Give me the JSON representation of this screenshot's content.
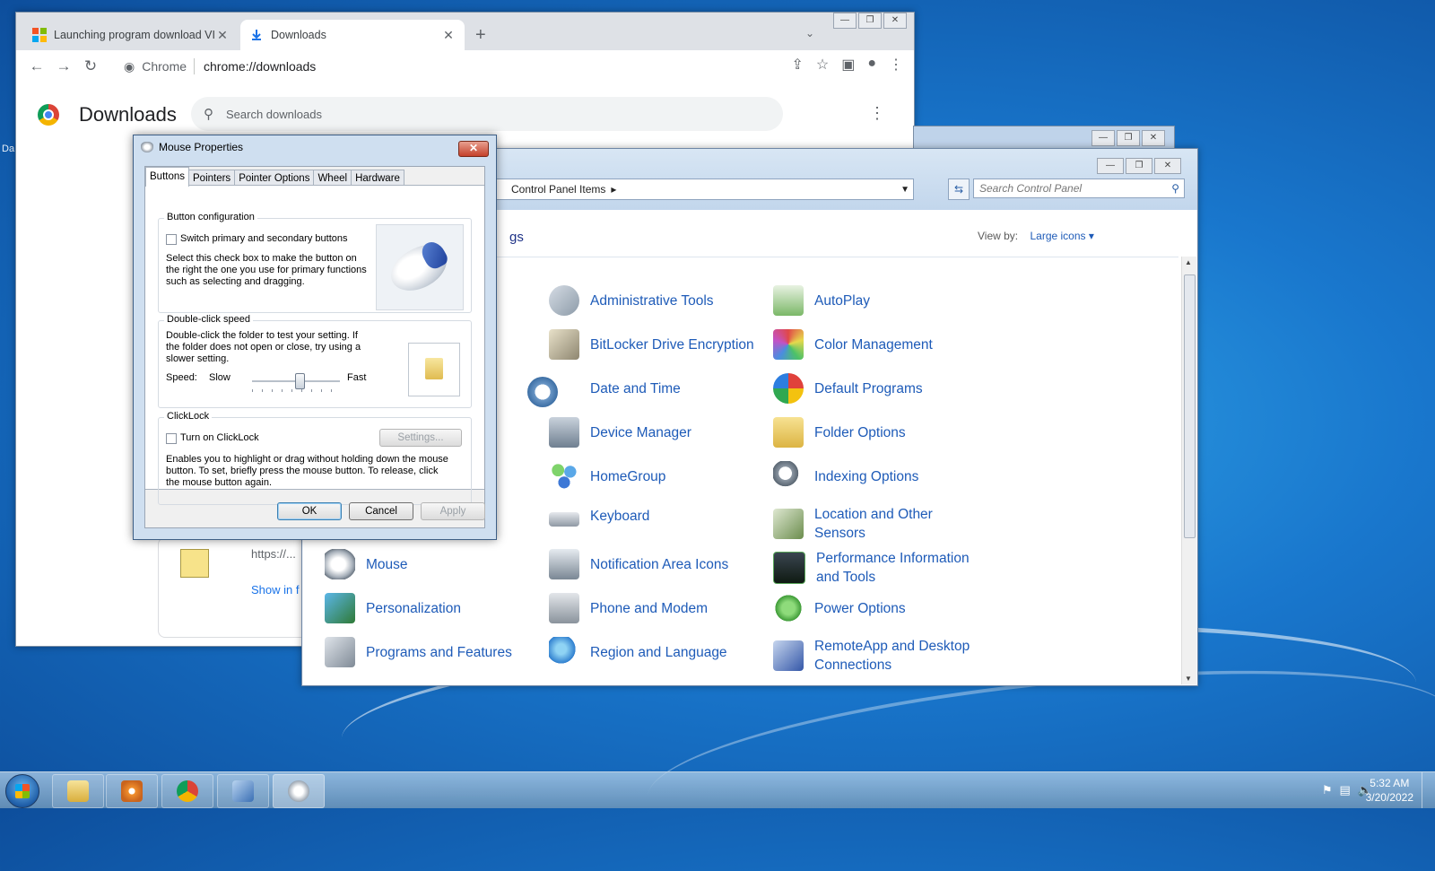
{
  "chrome": {
    "tabs": [
      {
        "title": "Launching program download VI",
        "icon": "windows-logo-icon"
      },
      {
        "title": "Downloads",
        "icon": "download-icon"
      }
    ],
    "new_tab": "+",
    "omnibox": {
      "site": "Chrome",
      "url": "chrome://downloads"
    },
    "page_title": "Downloads",
    "search_placeholder": "Search downloads",
    "download_item": {
      "url": "https://...",
      "show_in_folder": "Show in f"
    }
  },
  "control_panel": {
    "breadcrumb": "Control Panel Items",
    "search_placeholder": "Search Control Panel",
    "heading_fragment": "gs",
    "view_by_label": "View by:",
    "view_by_value": "Large icons",
    "items": [
      {
        "label": "Administrative Tools",
        "icon": "admin-tools-icon"
      },
      {
        "label": "AutoPlay",
        "icon": "autoplay-icon"
      },
      {
        "label": "BitLocker Drive Encryption",
        "icon": "bitlocker-icon"
      },
      {
        "label": "Color Management",
        "icon": "color-management-icon"
      },
      {
        "label": "Date and Time",
        "icon": "date-time-icon"
      },
      {
        "label": "Default Programs",
        "icon": "default-programs-icon"
      },
      {
        "label": "Device Manager",
        "icon": "device-manager-icon"
      },
      {
        "label": "Folder Options",
        "icon": "folder-options-icon"
      },
      {
        "label": "HomeGroup",
        "icon": "homegroup-icon"
      },
      {
        "label": "Indexing Options",
        "icon": "indexing-options-icon"
      },
      {
        "label": "Keyboard",
        "icon": "keyboard-icon"
      },
      {
        "label": "Location and Other Sensors",
        "icon": "location-sensors-icon"
      },
      {
        "label": "Mouse",
        "icon": "mouse-icon"
      },
      {
        "label": "Notification Area Icons",
        "icon": "notification-area-icon"
      },
      {
        "label": "Performance Information and Tools",
        "icon": "performance-icon"
      },
      {
        "label": "Personalization",
        "icon": "personalization-icon"
      },
      {
        "label": "Phone and Modem",
        "icon": "phone-modem-icon"
      },
      {
        "label": "Power Options",
        "icon": "power-options-icon"
      },
      {
        "label": "Programs and Features",
        "icon": "programs-features-icon"
      },
      {
        "label": "Region and Language",
        "icon": "region-language-icon"
      },
      {
        "label": "RemoteApp and Desktop Connections",
        "icon": "remoteapp-icon"
      }
    ]
  },
  "mouse_properties": {
    "title": "Mouse Properties",
    "close": "✕",
    "tabs": [
      "Buttons",
      "Pointers",
      "Pointer Options",
      "Wheel",
      "Hardware"
    ],
    "active_tab": "Buttons",
    "button_config": {
      "label": "Button configuration",
      "checkbox": "Switch primary and secondary buttons",
      "checked": false,
      "description": "Select this check box to make the button on the right the one you use for primary functions such as selecting and dragging."
    },
    "double_click": {
      "label": "Double-click speed",
      "description": "Double-click the folder to test your setting. If the folder does not open or close, try using a slower setting.",
      "speed_label": "Speed:",
      "slow": "Slow",
      "fast": "Fast",
      "speed_level": 0.55
    },
    "clicklock": {
      "label": "ClickLock",
      "checkbox": "Turn on ClickLock",
      "checked": false,
      "settings": "Settings...",
      "description": "Enables you to highlight or drag without holding down the mouse button. To set, briefly press the mouse button. To release, click the mouse button again."
    },
    "buttons": {
      "ok": "OK",
      "cancel": "Cancel",
      "apply": "Apply"
    }
  },
  "taskbar": {
    "apps": [
      "windows-explorer",
      "media-player",
      "chrome",
      "control-panel",
      "mouse-properties"
    ],
    "time": "5:32 AM",
    "date": "3/20/2022"
  }
}
